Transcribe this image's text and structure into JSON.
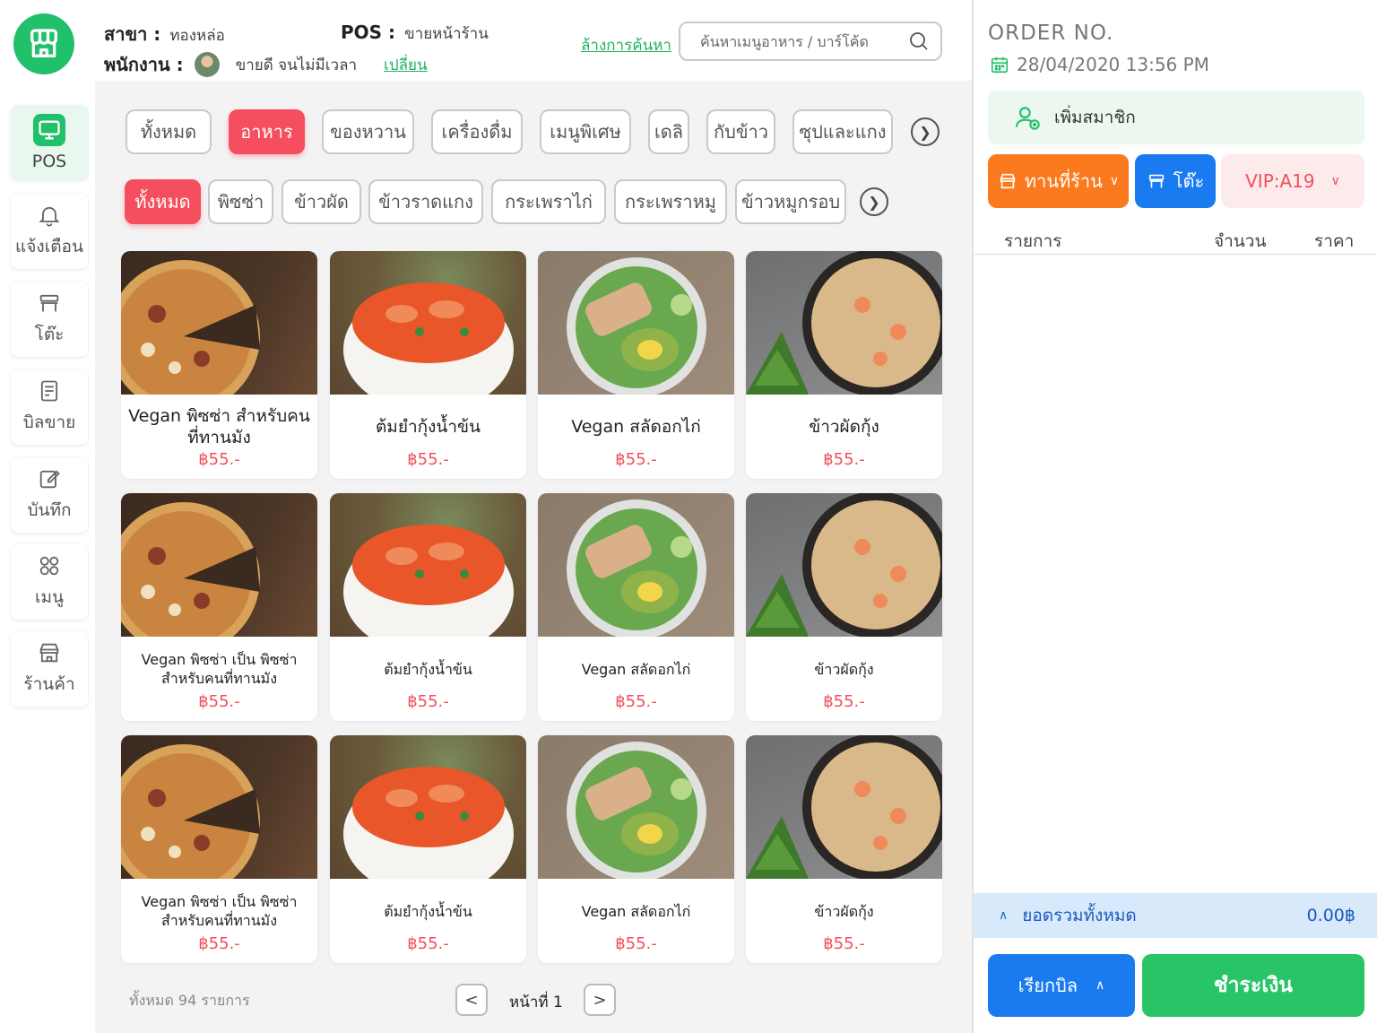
{
  "header": {
    "branch_label": "สาขา :",
    "branch_value": "ทองหล่อ",
    "pos_label": "POS :",
    "pos_value": "ขายหน้าร้าน",
    "staff_label": "พนักงาน :",
    "staff_name": "ขายดี จนไม่มีเวลา",
    "change_link": "เปลี่ยน",
    "clear_search_link": "ล้างการค้นหา",
    "search_placeholder": "ค้นหาเมนูอาหาร / บาร์โค้ด"
  },
  "sidebar": {
    "items": [
      {
        "label": "POS",
        "icon": "monitor-icon",
        "active": true
      },
      {
        "label": "แจ้งเตือน",
        "icon": "bell-icon"
      },
      {
        "label": "โต๊ะ",
        "icon": "table-icon"
      },
      {
        "label": "บิลขาย",
        "icon": "receipt-icon"
      },
      {
        "label": "บันทึก",
        "icon": "edit-icon"
      },
      {
        "label": "เมนู",
        "icon": "grid-icon"
      },
      {
        "label": "ร้านค้า",
        "icon": "store-icon"
      }
    ]
  },
  "categories": [
    "ทั้งหมด",
    "อาหาร",
    "ของหวาน",
    "เครื่องดื่ม",
    "เมนูพิเศษ",
    "เดลิ",
    "กับข้าว",
    "ซุปและแกง"
  ],
  "active_category": "อาหาร",
  "subcategories": [
    "ทั้งหมด",
    "พิซซ่า",
    "ข้าวผัด",
    "ข้าวราดแกง",
    "กระเพราไก่",
    "กระเพราหมู",
    "ข้าวหมูกรอบ"
  ],
  "active_subcategory": "ทั้งหมด",
  "products": [
    {
      "name": "Vegan พิซซ่า สำหรับคนที่ทานมัง",
      "price": "฿55.-",
      "image": "pizza"
    },
    {
      "name": "ต้มยำกุ้งน้ำข้น",
      "price": "฿55.-",
      "image": "soup"
    },
    {
      "name": "Vegan สลัดอกไก่",
      "price": "฿55.-",
      "image": "salad"
    },
    {
      "name": "ข้าวผัดกุ้ง",
      "price": "฿55.-",
      "image": "rice"
    },
    {
      "name": "Vegan พิซซ่า เป็น พิซซ่า สำหรับคนที่ทานมัง",
      "price": "฿55.-",
      "image": "pizza"
    },
    {
      "name": "ต้มยำกุ้งน้ำข้น",
      "price": "฿55.-",
      "image": "soup"
    },
    {
      "name": "Vegan สลัดอกไก่",
      "price": "฿55.-",
      "image": "salad"
    },
    {
      "name": "ข้าวผัดกุ้ง",
      "price": "฿55.-",
      "image": "rice"
    },
    {
      "name": "Vegan พิซซ่า เป็น พิซซ่า สำหรับคนที่ทานมัง",
      "price": "฿55.-",
      "image": "pizza"
    },
    {
      "name": "ต้มยำกุ้งน้ำข้น",
      "price": "฿55.-",
      "image": "soup"
    },
    {
      "name": "Vegan สลัดอกไก่",
      "price": "฿55.-",
      "image": "salad"
    },
    {
      "name": "ข้าวผัดกุ้ง",
      "price": "฿55.-",
      "image": "rice"
    }
  ],
  "pagination": {
    "total_text": "ทั้งหมด 94 รายการ",
    "page_text": "หน้าที่ 1",
    "prev": "<",
    "next": ">"
  },
  "order": {
    "title": "ORDER NO.",
    "datetime": "28/04/2020 13:56 PM",
    "add_member": "เพิ่มสมาชิก",
    "dine_in": "ทานที่ร้าน",
    "table": "โต๊ะ",
    "vip": "VIP:A19",
    "col_items": "รายการ",
    "col_qty": "จำนวน",
    "col_price": "ราคา",
    "total_label": "ยอดรวมทั้งหมด",
    "total_value": "0.00฿",
    "call_bill": "เรียกบิล",
    "pay": "ชำระเงิน"
  },
  "colors": {
    "brand_green": "#21c06a",
    "accent_red": "#f54e5e",
    "orange": "#fc7a1e",
    "blue": "#1a7bf0",
    "pay_green": "#29c466"
  }
}
